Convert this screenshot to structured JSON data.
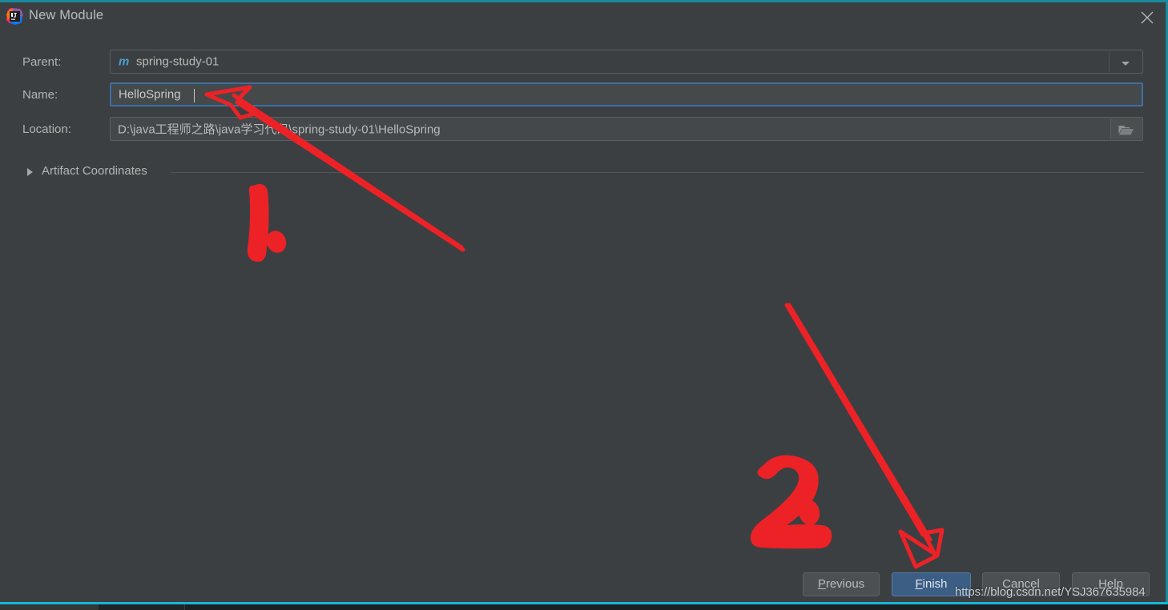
{
  "window": {
    "title": "New Module",
    "app_icon": "intellij-idea-icon",
    "close_icon": "close-icon",
    "accent_color": "#1a8a9c"
  },
  "form": {
    "parent": {
      "label": "Parent:",
      "value": "spring-study-01",
      "icon": "maven-module-icon",
      "icon_glyph": "m",
      "dropdown_icon": "chevron-down-icon"
    },
    "name": {
      "label": "Name:",
      "value": "HelloSpring",
      "placeholder": "",
      "focused": true
    },
    "location": {
      "label": "Location:",
      "value": "D:\\java工程师之路\\java学习代码\\spring-study-01\\HelloSpring",
      "browse_icon": "folder-icon"
    }
  },
  "section": {
    "artifact_coordinates": {
      "label": "Artifact Coordinates",
      "expanded": false,
      "toggle_icon": "chevron-right-icon"
    }
  },
  "buttons": {
    "previous": {
      "label": "Previous",
      "mnemonic": "P",
      "primary": false
    },
    "finish": {
      "label": "Finish",
      "mnemonic": "F",
      "primary": true
    },
    "cancel": {
      "label": "Cancel",
      "mnemonic": "",
      "primary": false
    },
    "help": {
      "label": "Help",
      "mnemonic": "",
      "primary": false
    }
  },
  "annotations": {
    "step_one": "1.",
    "step_two": "2.",
    "color": "#ec2227",
    "arrow_one_target": "name-input",
    "arrow_two_target": "finish-button"
  },
  "watermark": {
    "text": "https://blog.csdn.net/YSJ367635984"
  }
}
